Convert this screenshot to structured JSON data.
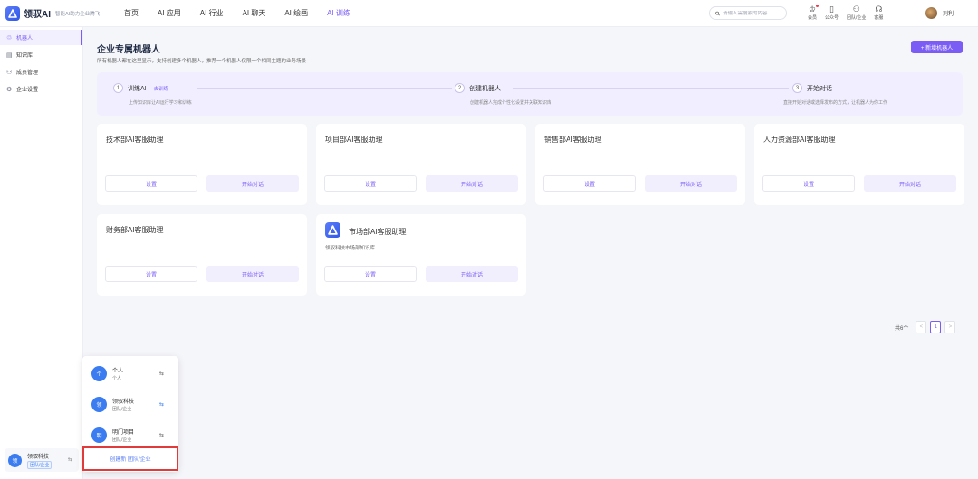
{
  "brand": {
    "name": "领驭AI",
    "slogan": "智能AI助力企业腾飞"
  },
  "nav": [
    {
      "label": "首页",
      "active": false
    },
    {
      "label": "AI 应用",
      "active": false
    },
    {
      "label": "AI 行业",
      "active": false
    },
    {
      "label": "AI 聊天",
      "active": false
    },
    {
      "label": "AI 绘画",
      "active": false
    },
    {
      "label": "AI 训练",
      "active": true
    }
  ],
  "search": {
    "placeholder": "请输入需搜索的内容"
  },
  "top_icons": [
    {
      "label": "会员",
      "icon": "crown-icon",
      "glyph": "♔"
    },
    {
      "label": "公众号",
      "icon": "phone-icon",
      "glyph": "▯"
    },
    {
      "label": "团队/企业",
      "icon": "user-add-icon",
      "glyph": "⚇"
    },
    {
      "label": "客服",
      "icon": "headset-icon",
      "glyph": "☊"
    }
  ],
  "user": {
    "name": "刘利"
  },
  "sidebar": {
    "items": [
      {
        "label": "机器人",
        "icon": "robot-icon",
        "glyph": "♲",
        "active": true
      },
      {
        "label": "知识库",
        "icon": "knowledge-icon",
        "glyph": "▤",
        "active": false
      },
      {
        "label": "成员管理",
        "icon": "members-icon",
        "glyph": "⚇",
        "active": false
      },
      {
        "label": "企业设置",
        "icon": "gear-icon",
        "glyph": "⚙",
        "active": false
      }
    ],
    "org": {
      "avatar": "领",
      "name": "领驭科技",
      "tag": "团队/企业"
    }
  },
  "popup": {
    "items": [
      {
        "avatar": "个",
        "name": "个人",
        "type": "个人"
      },
      {
        "avatar": "领",
        "name": "领驭科技",
        "type": "团队/企业"
      },
      {
        "avatar": "明",
        "name": "明门项目",
        "type": "团队/企业"
      }
    ],
    "create_label": "创建新 团队/企业"
  },
  "page": {
    "title": "企业专属机器人",
    "subtitle": "所有机器人都在这里显示，支持创建多个机器人，推荐一个机器人仅限一个相同主题的业务场景",
    "new_button": "+ 新增机器人"
  },
  "steps": [
    {
      "num": "1",
      "title": "训练AI",
      "link": "去训练",
      "desc": "上传知识库让AI运行学习和训练"
    },
    {
      "num": "2",
      "title": "创建机器人",
      "link": "",
      "desc": "创建机器人完成个性化设置并关联知识库"
    },
    {
      "num": "3",
      "title": "开始对话",
      "link": "",
      "desc": "直接开始对话或选择发布的方式，让机器人为你工作"
    }
  ],
  "cards": [
    {
      "title": "技术部AI客服助理",
      "desc": "",
      "logo": false
    },
    {
      "title": "项目部AI客服助理",
      "desc": "",
      "logo": false
    },
    {
      "title": "销售部AI客服助理",
      "desc": "",
      "logo": false
    },
    {
      "title": "人力资源部AI客服助理",
      "desc": "",
      "logo": false
    },
    {
      "title": "财务部AI客服助理",
      "desc": "",
      "logo": false
    },
    {
      "title": "市场部AI客服助理",
      "desc": "领驭科技市场部知识库",
      "logo": true
    }
  ],
  "card_buttons": {
    "settings": "设置",
    "chat": "开始对话"
  },
  "pagination": {
    "total": "共6个",
    "current": "1",
    "prev": "<",
    "next": ">"
  }
}
